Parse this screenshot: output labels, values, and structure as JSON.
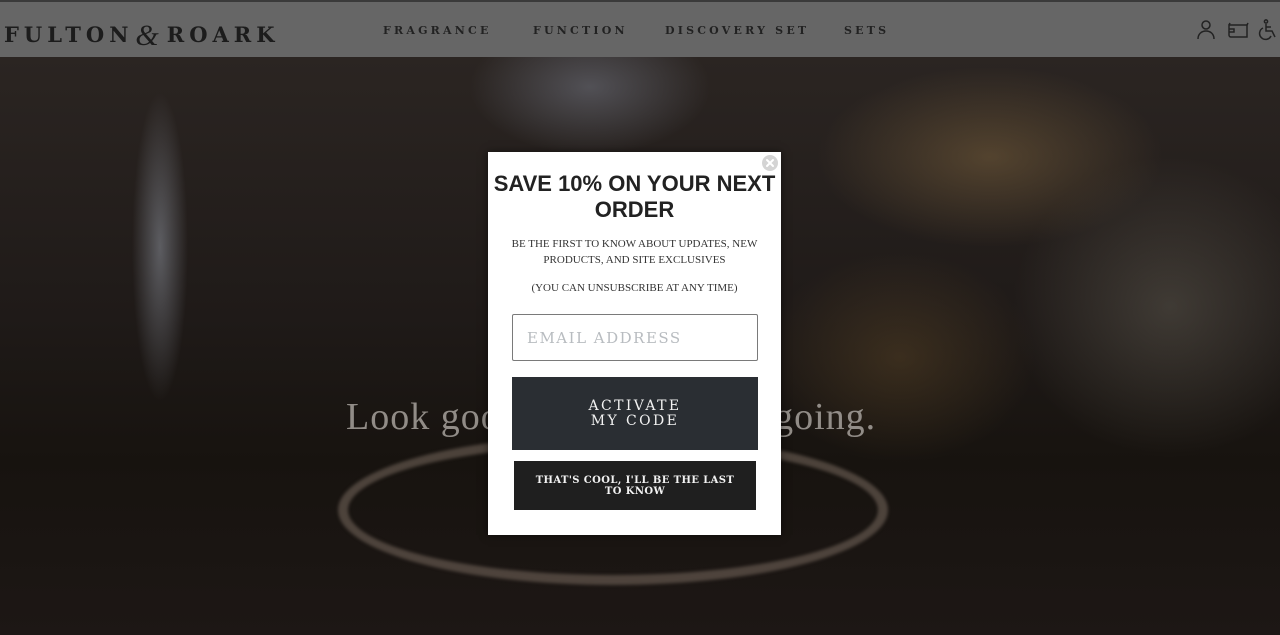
{
  "header": {
    "logo_left": "FULTON",
    "logo_amp": "&",
    "logo_right": "ROARK",
    "nav": [
      {
        "label": "FRAGRANCE"
      },
      {
        "label": "FUNCTION"
      },
      {
        "label": "DISCOVERY SET"
      },
      {
        "label": "SETS"
      }
    ],
    "icons": [
      "account-icon",
      "cart-icon",
      "accessibility-icon"
    ]
  },
  "hero": {
    "headline": "Look good, feel good, get going."
  },
  "popup": {
    "title": "SAVE 10% ON YOUR NEXT ORDER",
    "subtitle": "BE THE FIRST TO KNOW ABOUT UPDATES, NEW PRODUCTS, AND SITE EXCLUSIVES",
    "note": "(YOU CAN UNSUBSCRIBE AT ANY TIME)",
    "email_placeholder": "EMAIL ADDRESS",
    "email_value": "",
    "activate_label": "ACTIVATE MY CODE",
    "decline_label": "THAT'S COOL, I'LL BE THE LAST TO KNOW"
  },
  "colors": {
    "header_bg": "#666666",
    "primary_button": "#2a2e33",
    "secondary_button": "#1f1f1f",
    "popup_bg": "#ffffff"
  }
}
